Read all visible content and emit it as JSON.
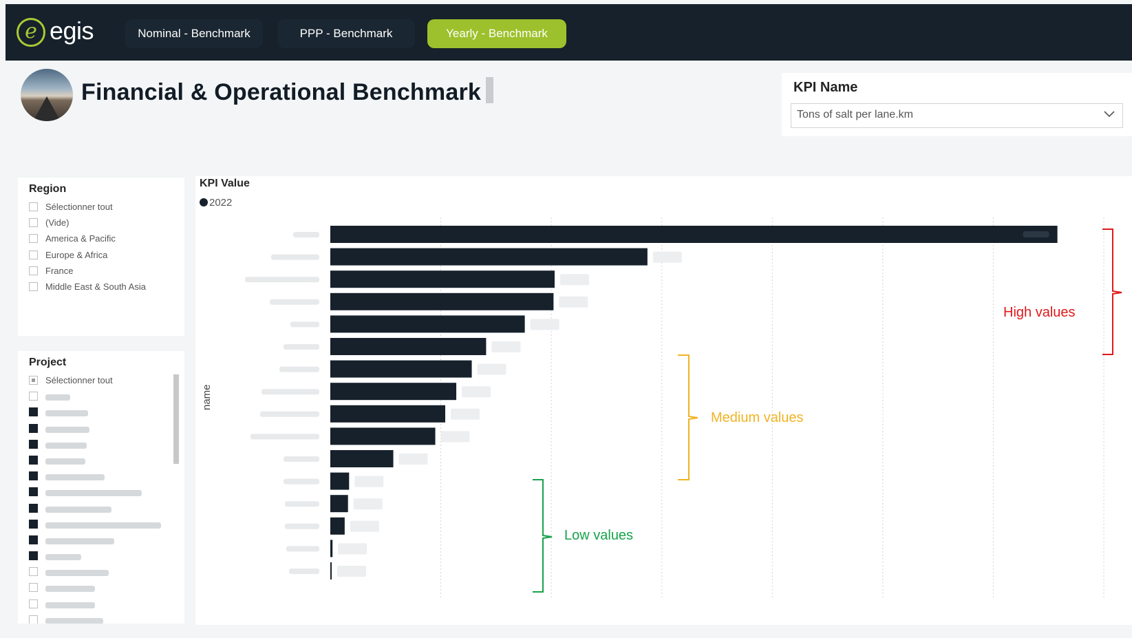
{
  "nav": {
    "logo_text": "egis",
    "tabs": [
      {
        "label": "Nominal - Benchmark",
        "active": false
      },
      {
        "label": "PPP - Benchmark",
        "active": false
      },
      {
        "label": "Yearly - Benchmark",
        "active": true
      }
    ]
  },
  "header": {
    "title": "Financial & Operational Benchmark"
  },
  "kpi_selector": {
    "label": "KPI Name",
    "value": "Tons of salt per lane.km"
  },
  "region_slicer": {
    "title": "Region",
    "items": [
      {
        "label": "Sélectionner tout",
        "state": "off"
      },
      {
        "label": "(Vide)",
        "state": "off"
      },
      {
        "label": "America & Pacific",
        "state": "off"
      },
      {
        "label": "Europe & Africa",
        "state": "off"
      },
      {
        "label": "France",
        "state": "off"
      },
      {
        "label": "Middle East & South Asia",
        "state": "off"
      }
    ]
  },
  "project_slicer": {
    "title": "Project",
    "select_all_label": "Sélectionner tout",
    "items_state": [
      "partial",
      "off",
      "on",
      "on",
      "on",
      "on",
      "on",
      "on",
      "on",
      "on",
      "on",
      "on",
      "off",
      "off",
      "off",
      "off"
    ]
  },
  "chart": {
    "title": "KPI Value",
    "legend_label": "2022",
    "y_axis_label": "name"
  },
  "chart_data": {
    "type": "bar",
    "orientation": "horizontal",
    "series": [
      {
        "name": "2022",
        "values": [
          6.58,
          2.87,
          2.03,
          2.02,
          1.76,
          1.41,
          1.28,
          1.14,
          1.04,
          0.95,
          0.57,
          0.17,
          0.16,
          0.13,
          0.02,
          0.01
        ]
      }
    ],
    "categories_redacted": true,
    "ylabel": "name",
    "grid": "vertical dotted",
    "colors": {
      "bar": "#16212b"
    }
  },
  "annotations": {
    "high": "High values",
    "medium": "Medium values",
    "low": "Low values",
    "colors": {
      "high": "#e0191b",
      "medium": "#f0b323",
      "low": "#16a34a"
    }
  }
}
